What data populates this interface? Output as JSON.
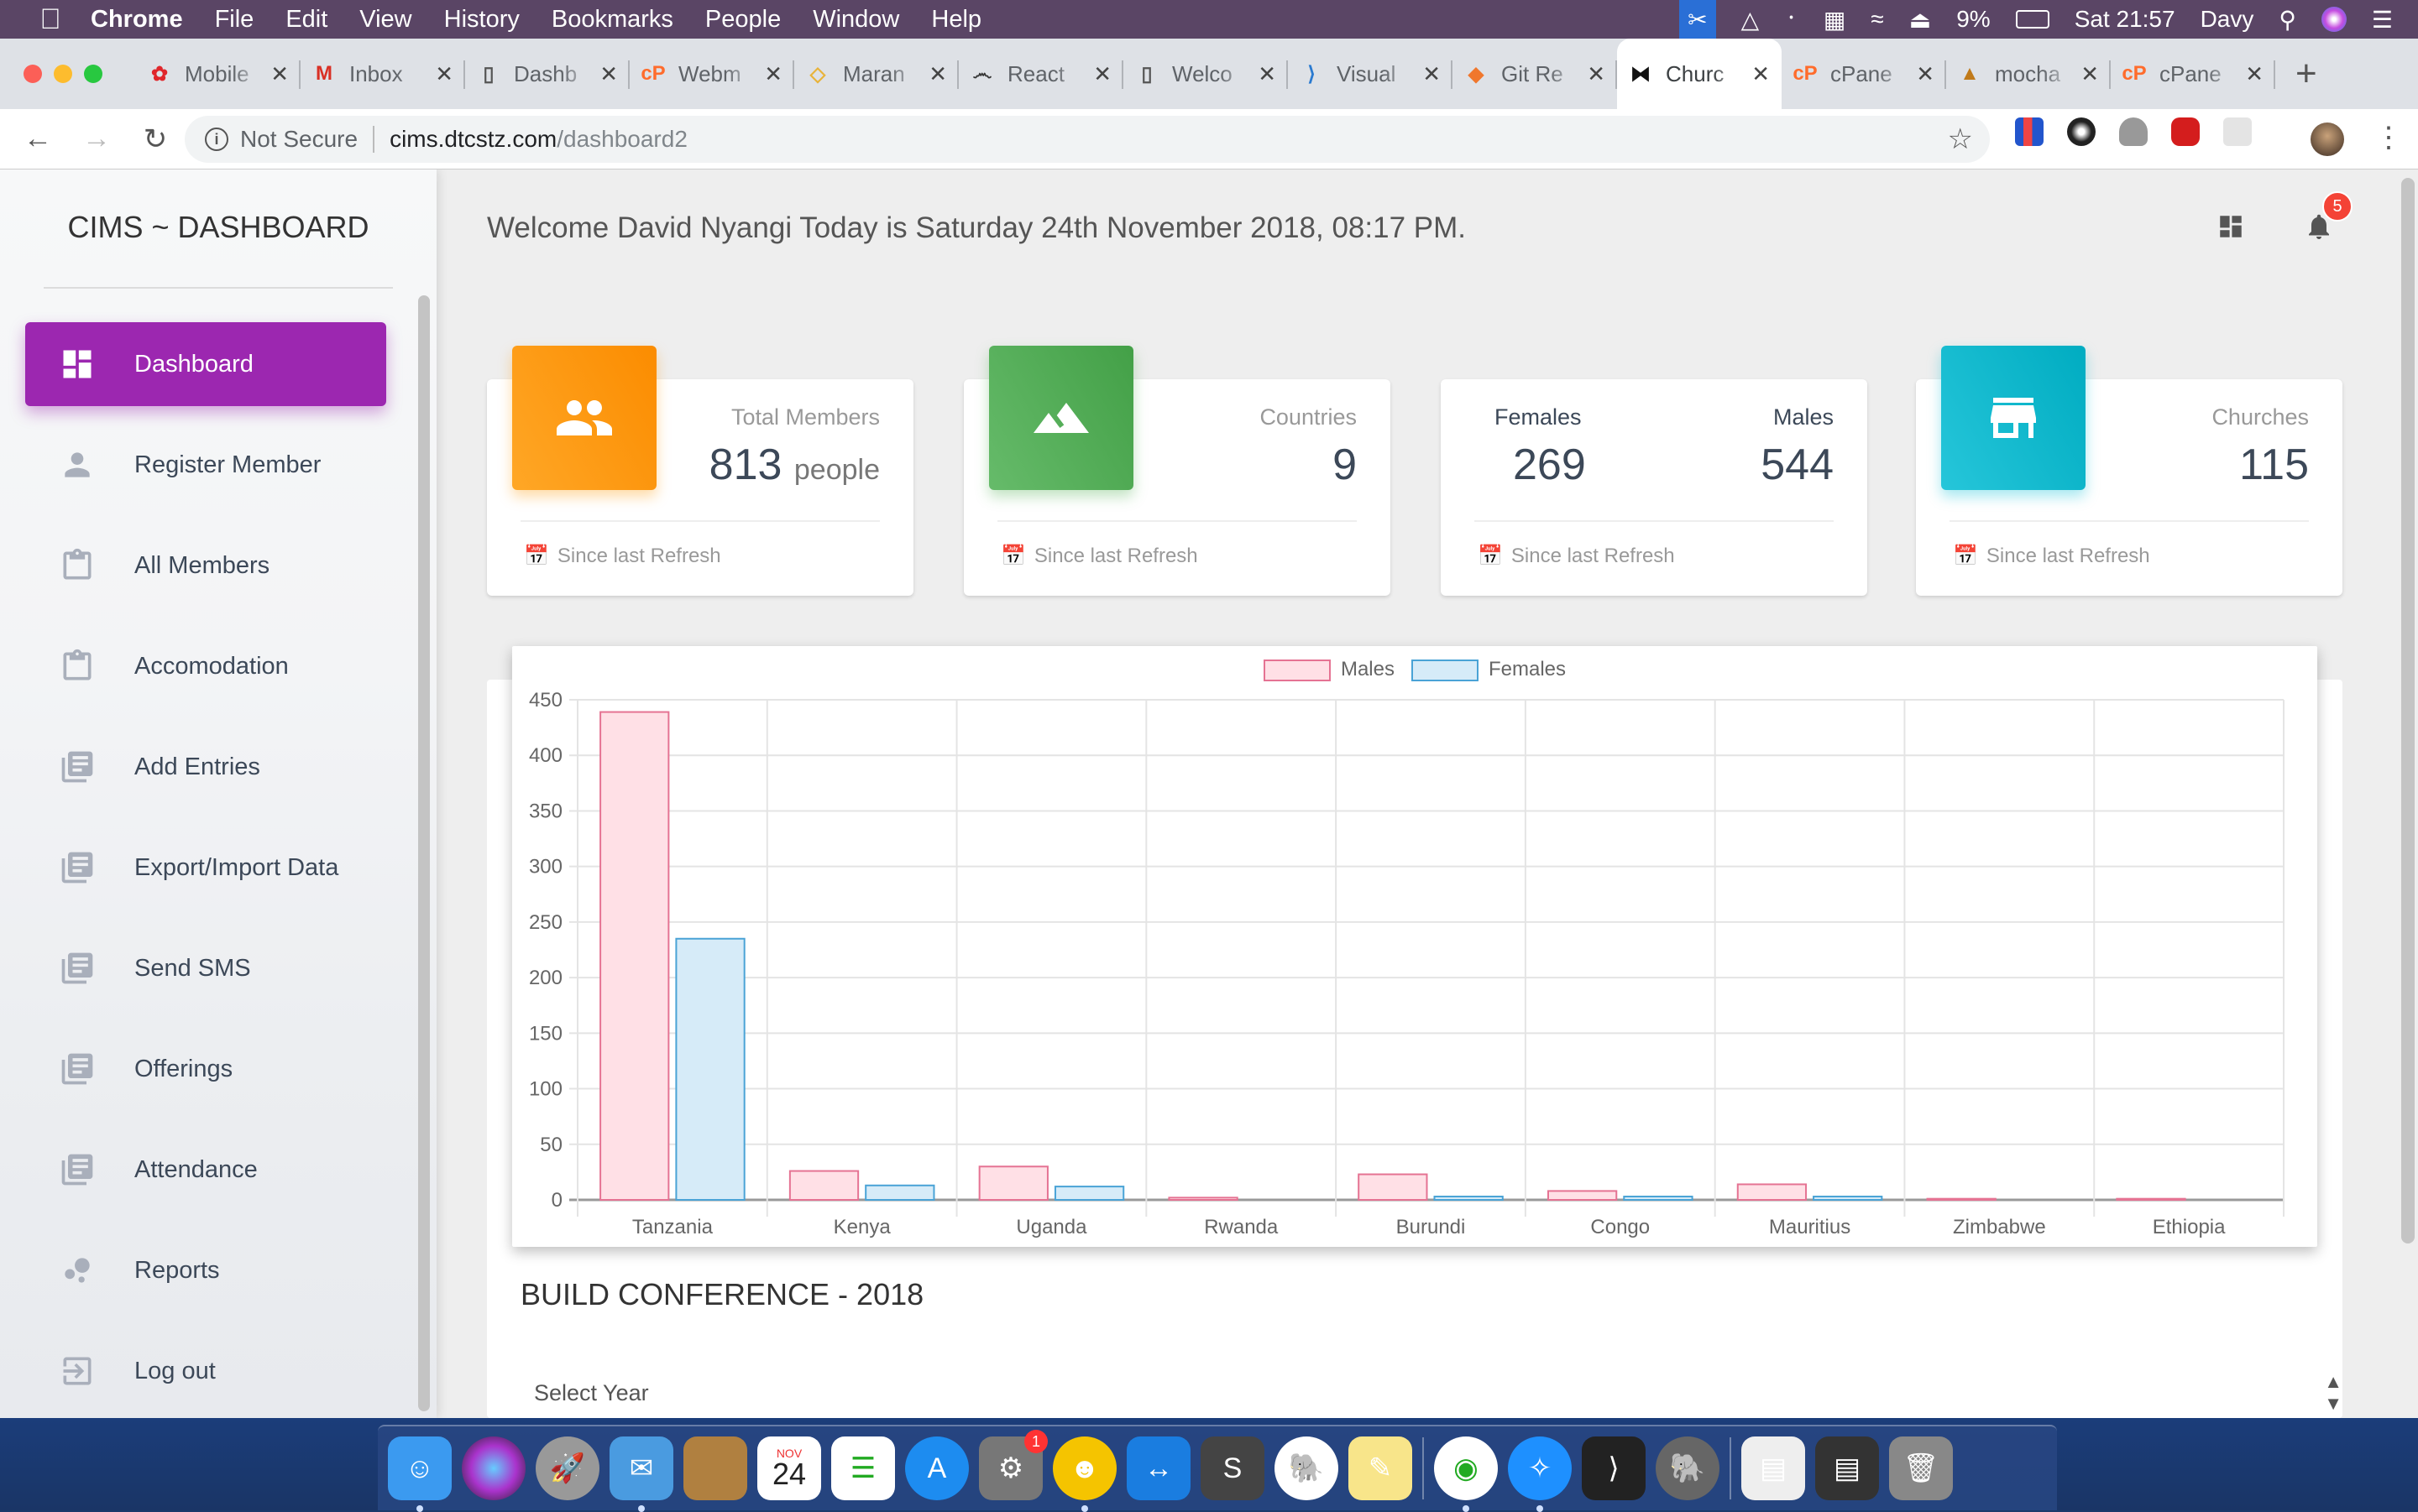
{
  "menubar": {
    "app": "Chrome",
    "items": [
      "File",
      "Edit",
      "View",
      "History",
      "Bookmarks",
      "People",
      "Window",
      "Help"
    ],
    "battery": "9%",
    "clock": "Sat 21:57",
    "user": "Davy"
  },
  "browser": {
    "tabs": [
      {
        "title": "Mobile",
        "icon": "huawei-icon",
        "color": "#e0262b"
      },
      {
        "title": "Inbox",
        "icon": "gmail-icon",
        "color": "#d93025"
      },
      {
        "title": "Dashb",
        "icon": "page-icon",
        "color": "#555555"
      },
      {
        "title": "Webm",
        "icon": "cpanel-icon",
        "color": "#ff6c2c"
      },
      {
        "title": "Maran",
        "icon": "maran-icon",
        "color": "#e8b33a"
      },
      {
        "title": "React",
        "icon": "mustache-icon",
        "color": "#333333"
      },
      {
        "title": "Welco",
        "icon": "page-icon",
        "color": "#555555"
      },
      {
        "title": "Visual",
        "icon": "vscode-icon",
        "color": "#2a7ad0"
      },
      {
        "title": "Git Re",
        "icon": "git-icon",
        "color": "#f0772d"
      },
      {
        "title": "Churc",
        "icon": "bowtie-icon",
        "color": "#111111",
        "active": true
      },
      {
        "title": "cPane",
        "icon": "cpanel-icon",
        "color": "#ff6c2c"
      },
      {
        "title": "mocha",
        "icon": "pma-icon",
        "color": "#c07a1a"
      },
      {
        "title": "cPane",
        "icon": "cpanel-icon",
        "color": "#ff6c2c"
      }
    ],
    "security_label": "Not Secure",
    "url_host": "cims.dtcstz.com",
    "url_path": "/dashboard2"
  },
  "sidebar": {
    "brand": "CIMS ~ DASHBOARD",
    "items": [
      {
        "label": "Dashboard",
        "icon": "dashboard-icon",
        "active": true
      },
      {
        "label": "Register Member",
        "icon": "person-icon"
      },
      {
        "label": "All Members",
        "icon": "clipboard-icon"
      },
      {
        "label": "Accomodation",
        "icon": "clipboard-icon"
      },
      {
        "label": "Add Entries",
        "icon": "library-books-icon"
      },
      {
        "label": "Export/Import Data",
        "icon": "library-books-icon"
      },
      {
        "label": "Send SMS",
        "icon": "library-books-icon"
      },
      {
        "label": "Offerings",
        "icon": "library-books-icon"
      },
      {
        "label": "Attendance",
        "icon": "library-books-icon"
      },
      {
        "label": "Reports",
        "icon": "bubble-chart-icon"
      },
      {
        "label": "Log out",
        "icon": "logout-icon"
      }
    ]
  },
  "header": {
    "welcome": "Welcome David Nyangi Today is Saturday 24th November 2018, 08:17 PM.",
    "notification_count": "5"
  },
  "cards": {
    "members": {
      "label": "Total Members",
      "value": "813",
      "unit": "people",
      "footer": "Since last Refresh",
      "color": "#fb8c00"
    },
    "countries": {
      "label": "Countries",
      "value": "9",
      "footer": "Since last Refresh",
      "color": "#43a047"
    },
    "gender": {
      "females_label": "Females",
      "females_value": "269",
      "males_label": "Males",
      "males_value": "544",
      "footer": "Since last Refresh"
    },
    "churches": {
      "label": "Churches",
      "value": "115",
      "footer": "Since last Refresh",
      "color": "#00acc1"
    }
  },
  "chart_data": {
    "type": "bar",
    "title": "",
    "xlabel": "",
    "ylabel": "",
    "categories": [
      "Tanzania",
      "Kenya",
      "Uganda",
      "Rwanda",
      "Burundi",
      "Congo",
      "Mauritius",
      "Zimbabwe",
      "Ethiopia"
    ],
    "series": [
      {
        "name": "Males",
        "values": [
          439,
          26,
          30,
          2,
          23,
          8,
          14,
          1,
          1
        ],
        "fill": "#ffe0e6",
        "stroke": "#e57393"
      },
      {
        "name": "Females",
        "values": [
          235,
          13,
          12,
          0,
          3,
          3,
          3,
          0,
          0
        ],
        "fill": "#d6ebf8",
        "stroke": "#4aa3d6"
      }
    ],
    "ylim": [
      0,
      450
    ],
    "yticks": [
      0,
      50,
      100,
      150,
      200,
      250,
      300,
      350,
      400,
      450
    ],
    "grid": true,
    "legend": "top-center"
  },
  "conference": {
    "title": "BUILD CONFERENCE - 2018",
    "select_placeholder": "Select Year"
  },
  "dock": {
    "apps": [
      "Finder",
      "Siri",
      "Launchpad",
      "Mail",
      "Contacts",
      "Calendar",
      "Reminders",
      "App Store",
      "System Preferences",
      "Lynda",
      "TeamViewer",
      "Sublime Text",
      "Evernote",
      "Stickies",
      "Chrome",
      "Safari",
      "Visual Studio Code",
      "TablePlus",
      "Preview",
      "Preview",
      "Trash"
    ],
    "calendar_month": "NOV",
    "calendar_day": "24",
    "sysprefs_badge": "1"
  }
}
